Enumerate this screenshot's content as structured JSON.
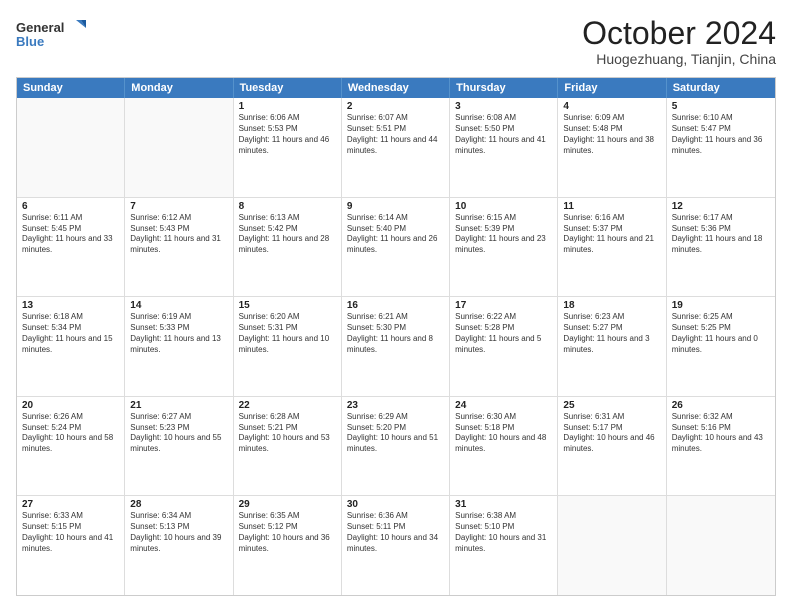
{
  "logo": {
    "line1": "General",
    "line2": "Blue"
  },
  "title": "October 2024",
  "location": "Huogezhuang, Tianjin, China",
  "header_days": [
    "Sunday",
    "Monday",
    "Tuesday",
    "Wednesday",
    "Thursday",
    "Friday",
    "Saturday"
  ],
  "weeks": [
    [
      {
        "day": "",
        "info": ""
      },
      {
        "day": "",
        "info": ""
      },
      {
        "day": "1",
        "info": "Sunrise: 6:06 AM\nSunset: 5:53 PM\nDaylight: 11 hours and 46 minutes."
      },
      {
        "day": "2",
        "info": "Sunrise: 6:07 AM\nSunset: 5:51 PM\nDaylight: 11 hours and 44 minutes."
      },
      {
        "day": "3",
        "info": "Sunrise: 6:08 AM\nSunset: 5:50 PM\nDaylight: 11 hours and 41 minutes."
      },
      {
        "day": "4",
        "info": "Sunrise: 6:09 AM\nSunset: 5:48 PM\nDaylight: 11 hours and 38 minutes."
      },
      {
        "day": "5",
        "info": "Sunrise: 6:10 AM\nSunset: 5:47 PM\nDaylight: 11 hours and 36 minutes."
      }
    ],
    [
      {
        "day": "6",
        "info": "Sunrise: 6:11 AM\nSunset: 5:45 PM\nDaylight: 11 hours and 33 minutes."
      },
      {
        "day": "7",
        "info": "Sunrise: 6:12 AM\nSunset: 5:43 PM\nDaylight: 11 hours and 31 minutes."
      },
      {
        "day": "8",
        "info": "Sunrise: 6:13 AM\nSunset: 5:42 PM\nDaylight: 11 hours and 28 minutes."
      },
      {
        "day": "9",
        "info": "Sunrise: 6:14 AM\nSunset: 5:40 PM\nDaylight: 11 hours and 26 minutes."
      },
      {
        "day": "10",
        "info": "Sunrise: 6:15 AM\nSunset: 5:39 PM\nDaylight: 11 hours and 23 minutes."
      },
      {
        "day": "11",
        "info": "Sunrise: 6:16 AM\nSunset: 5:37 PM\nDaylight: 11 hours and 21 minutes."
      },
      {
        "day": "12",
        "info": "Sunrise: 6:17 AM\nSunset: 5:36 PM\nDaylight: 11 hours and 18 minutes."
      }
    ],
    [
      {
        "day": "13",
        "info": "Sunrise: 6:18 AM\nSunset: 5:34 PM\nDaylight: 11 hours and 15 minutes."
      },
      {
        "day": "14",
        "info": "Sunrise: 6:19 AM\nSunset: 5:33 PM\nDaylight: 11 hours and 13 minutes."
      },
      {
        "day": "15",
        "info": "Sunrise: 6:20 AM\nSunset: 5:31 PM\nDaylight: 11 hours and 10 minutes."
      },
      {
        "day": "16",
        "info": "Sunrise: 6:21 AM\nSunset: 5:30 PM\nDaylight: 11 hours and 8 minutes."
      },
      {
        "day": "17",
        "info": "Sunrise: 6:22 AM\nSunset: 5:28 PM\nDaylight: 11 hours and 5 minutes."
      },
      {
        "day": "18",
        "info": "Sunrise: 6:23 AM\nSunset: 5:27 PM\nDaylight: 11 hours and 3 minutes."
      },
      {
        "day": "19",
        "info": "Sunrise: 6:25 AM\nSunset: 5:25 PM\nDaylight: 11 hours and 0 minutes."
      }
    ],
    [
      {
        "day": "20",
        "info": "Sunrise: 6:26 AM\nSunset: 5:24 PM\nDaylight: 10 hours and 58 minutes."
      },
      {
        "day": "21",
        "info": "Sunrise: 6:27 AM\nSunset: 5:23 PM\nDaylight: 10 hours and 55 minutes."
      },
      {
        "day": "22",
        "info": "Sunrise: 6:28 AM\nSunset: 5:21 PM\nDaylight: 10 hours and 53 minutes."
      },
      {
        "day": "23",
        "info": "Sunrise: 6:29 AM\nSunset: 5:20 PM\nDaylight: 10 hours and 51 minutes."
      },
      {
        "day": "24",
        "info": "Sunrise: 6:30 AM\nSunset: 5:18 PM\nDaylight: 10 hours and 48 minutes."
      },
      {
        "day": "25",
        "info": "Sunrise: 6:31 AM\nSunset: 5:17 PM\nDaylight: 10 hours and 46 minutes."
      },
      {
        "day": "26",
        "info": "Sunrise: 6:32 AM\nSunset: 5:16 PM\nDaylight: 10 hours and 43 minutes."
      }
    ],
    [
      {
        "day": "27",
        "info": "Sunrise: 6:33 AM\nSunset: 5:15 PM\nDaylight: 10 hours and 41 minutes."
      },
      {
        "day": "28",
        "info": "Sunrise: 6:34 AM\nSunset: 5:13 PM\nDaylight: 10 hours and 39 minutes."
      },
      {
        "day": "29",
        "info": "Sunrise: 6:35 AM\nSunset: 5:12 PM\nDaylight: 10 hours and 36 minutes."
      },
      {
        "day": "30",
        "info": "Sunrise: 6:36 AM\nSunset: 5:11 PM\nDaylight: 10 hours and 34 minutes."
      },
      {
        "day": "31",
        "info": "Sunrise: 6:38 AM\nSunset: 5:10 PM\nDaylight: 10 hours and 31 minutes."
      },
      {
        "day": "",
        "info": ""
      },
      {
        "day": "",
        "info": ""
      }
    ]
  ]
}
